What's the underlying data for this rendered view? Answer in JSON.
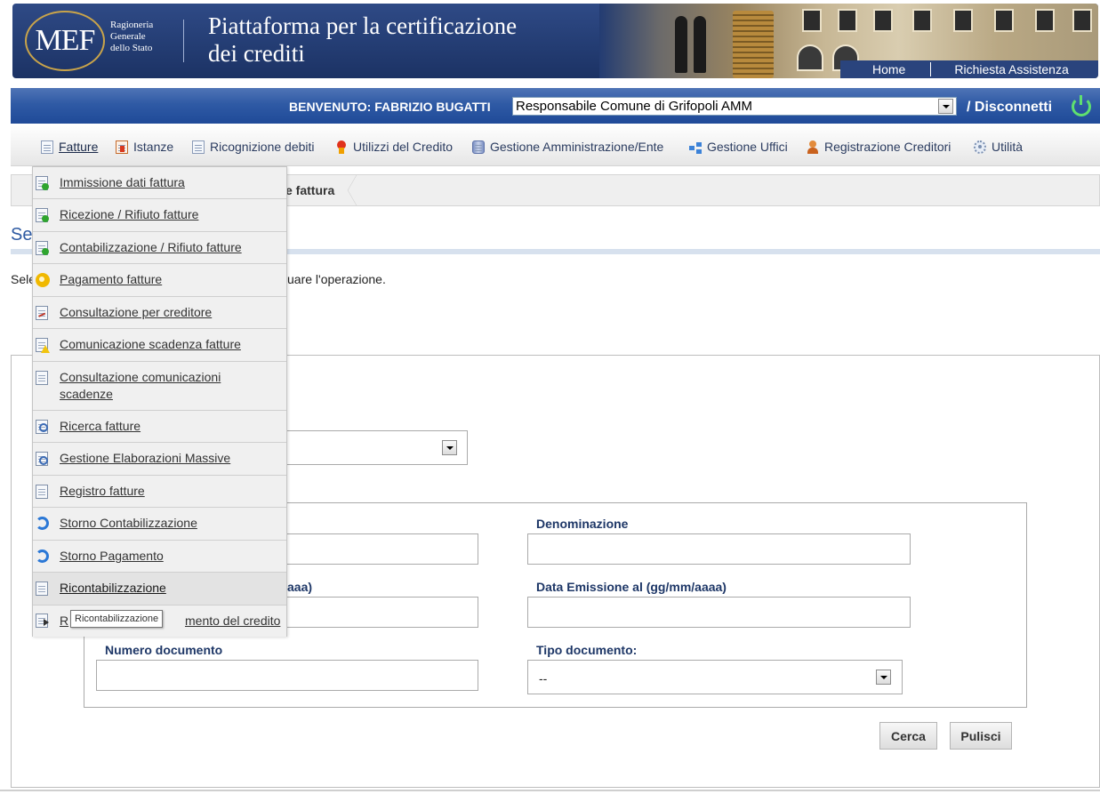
{
  "header": {
    "logo_text": "MEF",
    "org_lines": [
      "Ragioneria",
      "Generale",
      "dello Stato"
    ],
    "title_lines": [
      "Piattaforma per la certificazione",
      "dei crediti"
    ],
    "links": {
      "home": "Home",
      "assistance": "Richiesta Assistenza"
    }
  },
  "welcome": {
    "text": "BENVENUTO: FABRIZIO BUGATTI",
    "profile": "Responsabile Comune di Grifopoli AMM",
    "disconnect": "/ Disconnetti"
  },
  "menu": {
    "items": [
      {
        "label": "Fatture",
        "icon": "document-icon"
      },
      {
        "label": "Istanze",
        "icon": "istanze-icon"
      },
      {
        "label": "Ricognizione debiti",
        "icon": "document-icon"
      },
      {
        "label": "Utilizzi del Credito",
        "icon": "ribbon-icon"
      },
      {
        "label": "Gestione Amministrazione/Ente",
        "icon": "database-icon"
      },
      {
        "label": "Gestione Uffici",
        "icon": "hierarchy-icon"
      },
      {
        "label": "Registrazione Creditori",
        "icon": "user-icon"
      },
      {
        "label": "Utilità",
        "icon": "gear-icon"
      }
    ]
  },
  "breadcrumb": {
    "current": "e fattura"
  },
  "page": {
    "title_prefix": "Se",
    "intro_prefix": "Sele",
    "intro_text": "uare l'operazione."
  },
  "form": {
    "labels": {
      "date_from_suffix": "aaa)",
      "denominazione": "Denominazione",
      "data_emissione_al": "Data Emissione al (gg/mm/aaaa)",
      "numero_documento": "Numero documento",
      "tipo_documento": "Tipo documento:"
    },
    "tipo_documento_value": "--",
    "buttons": {
      "cerca": "Cerca",
      "pulisci": "Pulisci"
    }
  },
  "dropdown": {
    "items": [
      {
        "label": "Immissione dati fattura",
        "icon": "add-document-icon"
      },
      {
        "label": "Ricezione / Rifiuto fatture",
        "icon": "receive-document-icon"
      },
      {
        "label": "Contabilizzazione / Rifiuto fatture",
        "icon": "check-document-icon"
      },
      {
        "label": "Pagamento fatture",
        "icon": "coin-icon"
      },
      {
        "label": "Consultazione per creditore",
        "icon": "chart-document-icon"
      },
      {
        "label": "Comunicazione scadenza fatture",
        "icon": "warning-document-icon"
      },
      {
        "label": "Consultazione comunicazioni scadenze",
        "icon": "list-document-icon"
      },
      {
        "label": "Ricerca fatture",
        "icon": "search-document-icon"
      },
      {
        "label": "Gestione Elaborazioni Massive",
        "icon": "gear-document-icon"
      },
      {
        "label": "Registro fatture",
        "icon": "register-document-icon"
      },
      {
        "label": "Storno Contabilizzazione",
        "icon": "undo-icon"
      },
      {
        "label": "Storno Pagamento",
        "icon": "undo-icon"
      },
      {
        "label": "Ricontabilizzazione",
        "icon": "document-icon"
      },
      {
        "label_prefix": "R",
        "label_suffix": "mento del credito",
        "icon": "export-icon"
      }
    ],
    "tooltip": "Ricontabilizzazione"
  }
}
